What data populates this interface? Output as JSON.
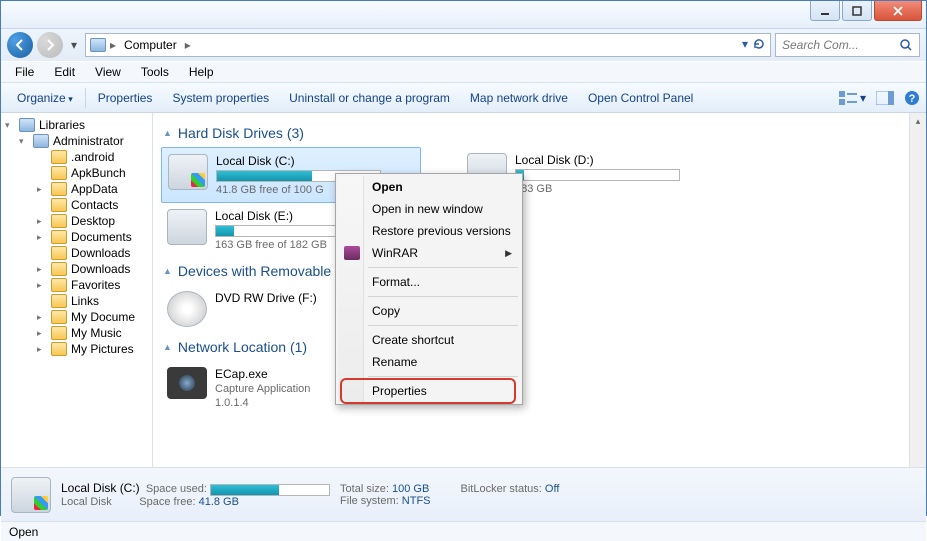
{
  "address": {
    "path_root": "Computer"
  },
  "search": {
    "placeholder": "Search Com..."
  },
  "menubar": [
    "File",
    "Edit",
    "View",
    "Tools",
    "Help"
  ],
  "toolbar": {
    "organize": "Organize",
    "items": [
      "Properties",
      "System properties",
      "Uninstall or change a program",
      "Map network drive",
      "Open Control Panel"
    ]
  },
  "tree": [
    {
      "label": "Libraries",
      "icon": "lib",
      "indent": 0,
      "exp": "▾"
    },
    {
      "label": "Administrator",
      "icon": "lib",
      "indent": 1,
      "exp": "▾"
    },
    {
      "label": ".android",
      "icon": "folder",
      "indent": 2,
      "exp": ""
    },
    {
      "label": "ApkBunch",
      "icon": "folder",
      "indent": 2,
      "exp": ""
    },
    {
      "label": "AppData",
      "icon": "folder",
      "indent": 2,
      "exp": "▸"
    },
    {
      "label": "Contacts",
      "icon": "folder",
      "indent": 2,
      "exp": ""
    },
    {
      "label": "Desktop",
      "icon": "folder",
      "indent": 2,
      "exp": "▸"
    },
    {
      "label": "Documents",
      "icon": "folder",
      "indent": 2,
      "exp": "▸"
    },
    {
      "label": "Downloads",
      "icon": "folder",
      "indent": 2,
      "exp": ""
    },
    {
      "label": "Downloads",
      "icon": "folder",
      "indent": 2,
      "exp": "▸"
    },
    {
      "label": "Favorites",
      "icon": "folder",
      "indent": 2,
      "exp": "▸"
    },
    {
      "label": "Links",
      "icon": "folder",
      "indent": 2,
      "exp": ""
    },
    {
      "label": "My Docume",
      "icon": "folder",
      "indent": 2,
      "exp": "▸"
    },
    {
      "label": "My Music",
      "icon": "folder",
      "indent": 2,
      "exp": "▸"
    },
    {
      "label": "My Pictures",
      "icon": "folder",
      "indent": 2,
      "exp": "▸"
    }
  ],
  "groups": {
    "hdd": {
      "title": "Hard Disk Drives (3)"
    },
    "dev": {
      "title": "Devices with Removable"
    },
    "net": {
      "title": "Network Location (1)"
    }
  },
  "drives": {
    "c": {
      "name": "Local Disk (C:)",
      "sub": "41.8 GB free of 100 G",
      "fill": 58
    },
    "d": {
      "name": "Local Disk (D:)",
      "sub": "183 GB",
      "fill": 5
    },
    "e": {
      "name": "Local Disk (E:)",
      "sub": "163 GB free of 182 GB",
      "fill": 11
    },
    "dvd": {
      "name": "DVD RW Drive (F:)"
    },
    "ecap": {
      "name": "ECap.exe",
      "sub": "Capture Application",
      "ver": "1.0.1.4"
    }
  },
  "details": {
    "title": "Local Disk (C:)",
    "type": "Local Disk",
    "space_used_label": "Space used:",
    "space_free_label": "Space free:",
    "space_free_val": "41.8 GB",
    "total_label": "Total size:",
    "total_val": "100 GB",
    "fs_label": "File system:",
    "fs_val": "NTFS",
    "bitlocker_label": "BitLocker status:",
    "bitlocker_val": "Off"
  },
  "status": "Open",
  "context_menu": [
    {
      "label": "Open",
      "bold": true
    },
    {
      "label": "Open in new window"
    },
    {
      "label": "Restore previous versions"
    },
    {
      "label": "WinRAR",
      "submenu": true,
      "icon": "winrar"
    },
    {
      "sep": true
    },
    {
      "label": "Format..."
    },
    {
      "sep": true
    },
    {
      "label": "Copy"
    },
    {
      "sep": true
    },
    {
      "label": "Create shortcut"
    },
    {
      "label": "Rename"
    },
    {
      "sep": true
    },
    {
      "label": "Properties",
      "highlight": true
    }
  ]
}
